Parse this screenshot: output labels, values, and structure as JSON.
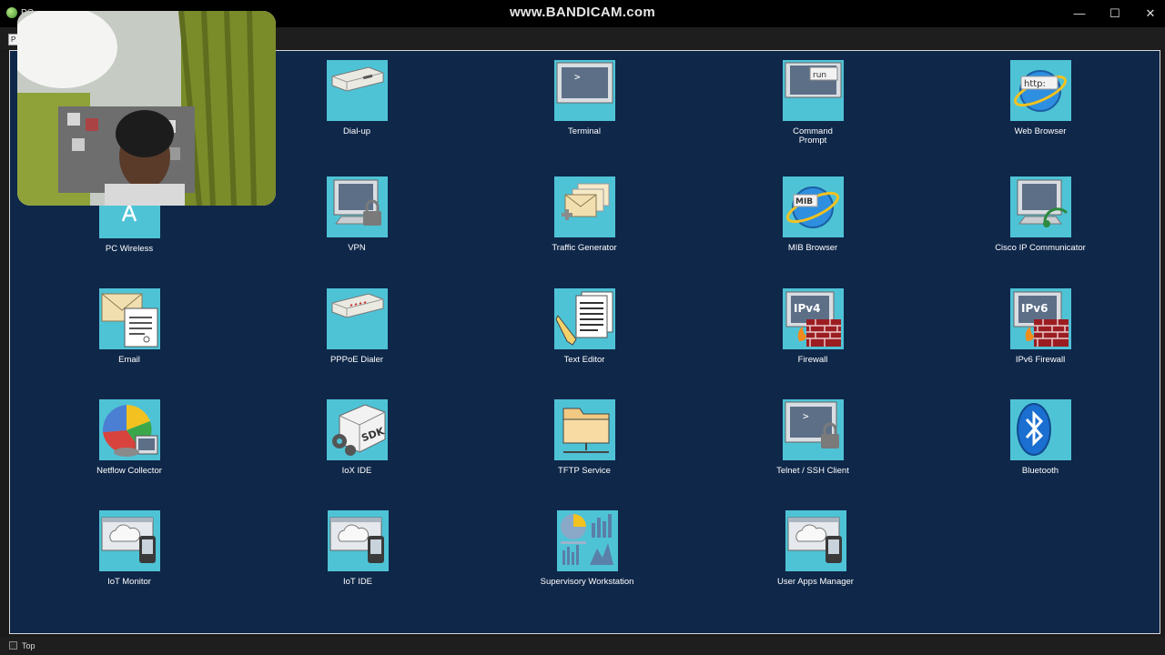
{
  "window": {
    "title": "PC",
    "watermark": "www.BANDICAM.com",
    "tab": "P",
    "minimize": "—",
    "maximize": "☐",
    "close": "✕"
  },
  "desktop_apps": [
    {
      "label": "PC Wireless",
      "icon": "wireless-icon"
    },
    {
      "label": "Dial-up",
      "icon": "modem-icon"
    },
    {
      "label": "Terminal",
      "icon": "terminal-icon"
    },
    {
      "label": "Command\nPrompt",
      "icon": "command-prompt-icon"
    },
    {
      "label": "Web Browser",
      "icon": "web-browser-icon"
    },
    {
      "label": "VPN",
      "icon": "vpn-icon"
    },
    {
      "label": "Traffic Generator",
      "icon": "traffic-generator-icon"
    },
    {
      "label": "MIB Browser",
      "icon": "mib-browser-icon"
    },
    {
      "label": "Cisco IP Communicator",
      "icon": "ip-communicator-icon"
    },
    {
      "label": "Email",
      "icon": "email-icon"
    },
    {
      "label": "PPPoE Dialer",
      "icon": "pppoe-dialer-icon"
    },
    {
      "label": "Text Editor",
      "icon": "text-editor-icon"
    },
    {
      "label": "Firewall",
      "icon": "firewall-icon"
    },
    {
      "label": "IPv6 Firewall",
      "icon": "ipv6-firewall-icon"
    },
    {
      "label": "Netflow Collector",
      "icon": "netflow-collector-icon"
    },
    {
      "label": "IoX IDE",
      "icon": "iox-ide-icon"
    },
    {
      "label": "TFTP Service",
      "icon": "tftp-service-icon"
    },
    {
      "label": "Telnet / SSH Client",
      "icon": "telnet-ssh-icon"
    },
    {
      "label": "Bluetooth",
      "icon": "bluetooth-icon"
    },
    {
      "label": "IoT Monitor",
      "icon": "iot-monitor-icon"
    },
    {
      "label": "IoT IDE",
      "icon": "iot-ide-icon"
    },
    {
      "label": "Supervisory Workstation",
      "icon": "supervisory-workstation-icon"
    },
    {
      "label": "User Apps Manager",
      "icon": "user-apps-manager-icon"
    }
  ],
  "icon_text": {
    "terminal": ">",
    "run": "run",
    "http": "http:",
    "mib": "MIB",
    "ipv4": "IPv4",
    "ipv6": "IPv6",
    "sdk": "SDK",
    "telnet": ">"
  },
  "status": {
    "top_label": "Top"
  },
  "colors": {
    "desktop_bg": "#0f2749",
    "tile_bg": "#4fc3d6"
  }
}
